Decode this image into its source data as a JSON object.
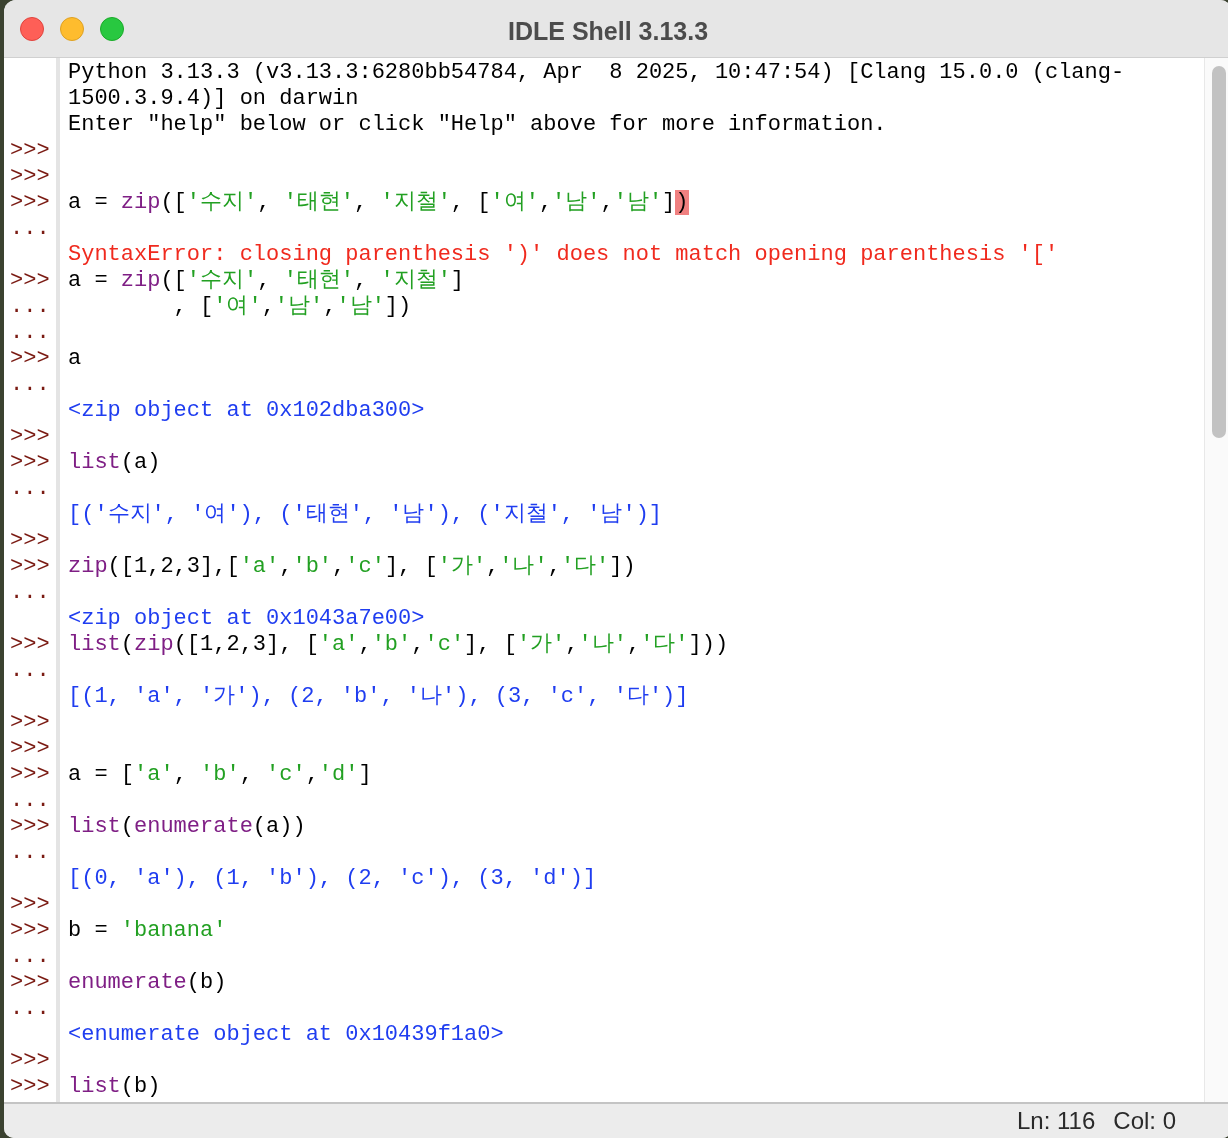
{
  "window": {
    "title": "IDLE Shell 3.13.3"
  },
  "lines": [
    {
      "segments": [
        {
          "text": "Python 3.13.3 (v3.13.3:6280bb54784, Apr  8 2025, 10:47:54) [Clang 15.0.0 (clang-",
          "kind": "plain"
        }
      ]
    },
    {
      "segments": [
        {
          "text": "1500.3.9.4)] on darwin",
          "kind": "plain"
        }
      ]
    },
    {
      "segments": [
        {
          "text": "Enter \"help\" below or click \"Help\" above for more information.",
          "kind": "plain"
        }
      ]
    },
    {
      "prompt": ">>>"
    },
    {
      "prompt": ">>>"
    },
    {
      "prompt": ">>>",
      "segments": [
        {
          "text": "a = ",
          "kind": "plain"
        },
        {
          "text": "zip",
          "kind": "builtin"
        },
        {
          "text": "([",
          "kind": "plain"
        },
        {
          "text": "'수지'",
          "kind": "string"
        },
        {
          "text": ", ",
          "kind": "plain"
        },
        {
          "text": "'태현'",
          "kind": "string"
        },
        {
          "text": ", ",
          "kind": "plain"
        },
        {
          "text": "'지철'",
          "kind": "string"
        },
        {
          "text": ", [",
          "kind": "plain"
        },
        {
          "text": "'여'",
          "kind": "string"
        },
        {
          "text": ",",
          "kind": "plain"
        },
        {
          "text": "'남'",
          "kind": "string"
        },
        {
          "text": ",",
          "kind": "plain"
        },
        {
          "text": "'남'",
          "kind": "string"
        },
        {
          "text": "]",
          "kind": "plain"
        },
        {
          "text": ")",
          "kind": "highlight"
        }
      ]
    },
    {
      "prompt": "..."
    },
    {
      "segments": [
        {
          "text": "SyntaxError: closing parenthesis ')' does not match opening parenthesis '['",
          "kind": "error"
        }
      ]
    },
    {
      "prompt": ">>>",
      "segments": [
        {
          "text": "a = ",
          "kind": "plain"
        },
        {
          "text": "zip",
          "kind": "builtin"
        },
        {
          "text": "([",
          "kind": "plain"
        },
        {
          "text": "'수지'",
          "kind": "string"
        },
        {
          "text": ", ",
          "kind": "plain"
        },
        {
          "text": "'태현'",
          "kind": "string"
        },
        {
          "text": ", ",
          "kind": "plain"
        },
        {
          "text": "'지철'",
          "kind": "string"
        },
        {
          "text": "]",
          "kind": "plain"
        }
      ]
    },
    {
      "prompt": "...",
      "segments": [
        {
          "text": "        , [",
          "kind": "plain"
        },
        {
          "text": "'여'",
          "kind": "string"
        },
        {
          "text": ",",
          "kind": "plain"
        },
        {
          "text": "'남'",
          "kind": "string"
        },
        {
          "text": ",",
          "kind": "plain"
        },
        {
          "text": "'남'",
          "kind": "string"
        },
        {
          "text": "])",
          "kind": "plain"
        }
      ]
    },
    {
      "prompt": "..."
    },
    {
      "prompt": ">>>",
      "segments": [
        {
          "text": "a",
          "kind": "plain"
        }
      ]
    },
    {
      "prompt": "..."
    },
    {
      "segments": [
        {
          "text": "<zip object at 0x102dba300>",
          "kind": "output"
        }
      ]
    },
    {
      "prompt": ">>>"
    },
    {
      "prompt": ">>>",
      "segments": [
        {
          "text": "list",
          "kind": "builtin"
        },
        {
          "text": "(a)",
          "kind": "plain"
        }
      ]
    },
    {
      "prompt": "..."
    },
    {
      "segments": [
        {
          "text": "[('수지', '여'), ('태현', '남'), ('지철', '남')]",
          "kind": "output"
        }
      ]
    },
    {
      "prompt": ">>>"
    },
    {
      "prompt": ">>>",
      "segments": [
        {
          "text": "zip",
          "kind": "builtin"
        },
        {
          "text": "([1,2,3],[",
          "kind": "plain"
        },
        {
          "text": "'a'",
          "kind": "string"
        },
        {
          "text": ",",
          "kind": "plain"
        },
        {
          "text": "'b'",
          "kind": "string"
        },
        {
          "text": ",",
          "kind": "plain"
        },
        {
          "text": "'c'",
          "kind": "string"
        },
        {
          "text": "], [",
          "kind": "plain"
        },
        {
          "text": "'가'",
          "kind": "string"
        },
        {
          "text": ",",
          "kind": "plain"
        },
        {
          "text": "'나'",
          "kind": "string"
        },
        {
          "text": ",",
          "kind": "plain"
        },
        {
          "text": "'다'",
          "kind": "string"
        },
        {
          "text": "])",
          "kind": "plain"
        }
      ]
    },
    {
      "prompt": "..."
    },
    {
      "segments": [
        {
          "text": "<zip object at 0x1043a7e00>",
          "kind": "output"
        }
      ]
    },
    {
      "prompt": ">>>",
      "segments": [
        {
          "text": "list",
          "kind": "builtin"
        },
        {
          "text": "(",
          "kind": "plain"
        },
        {
          "text": "zip",
          "kind": "builtin"
        },
        {
          "text": "([1,2,3], [",
          "kind": "plain"
        },
        {
          "text": "'a'",
          "kind": "string"
        },
        {
          "text": ",",
          "kind": "plain"
        },
        {
          "text": "'b'",
          "kind": "string"
        },
        {
          "text": ",",
          "kind": "plain"
        },
        {
          "text": "'c'",
          "kind": "string"
        },
        {
          "text": "], [",
          "kind": "plain"
        },
        {
          "text": "'가'",
          "kind": "string"
        },
        {
          "text": ",",
          "kind": "plain"
        },
        {
          "text": "'나'",
          "kind": "string"
        },
        {
          "text": ",",
          "kind": "plain"
        },
        {
          "text": "'다'",
          "kind": "string"
        },
        {
          "text": "]))",
          "kind": "plain"
        }
      ]
    },
    {
      "prompt": "..."
    },
    {
      "segments": [
        {
          "text": "[(1, 'a', '가'), (2, 'b', '나'), (3, 'c', '다')]",
          "kind": "output"
        }
      ]
    },
    {
      "prompt": ">>>"
    },
    {
      "prompt": ">>>"
    },
    {
      "prompt": ">>>",
      "segments": [
        {
          "text": "a = [",
          "kind": "plain"
        },
        {
          "text": "'a'",
          "kind": "string"
        },
        {
          "text": ", ",
          "kind": "plain"
        },
        {
          "text": "'b'",
          "kind": "string"
        },
        {
          "text": ", ",
          "kind": "plain"
        },
        {
          "text": "'c'",
          "kind": "string"
        },
        {
          "text": ",",
          "kind": "plain"
        },
        {
          "text": "'d'",
          "kind": "string"
        },
        {
          "text": "]",
          "kind": "plain"
        }
      ]
    },
    {
      "prompt": "..."
    },
    {
      "prompt": ">>>",
      "segments": [
        {
          "text": "list",
          "kind": "builtin"
        },
        {
          "text": "(",
          "kind": "plain"
        },
        {
          "text": "enumerate",
          "kind": "builtin"
        },
        {
          "text": "(a))",
          "kind": "plain"
        }
      ]
    },
    {
      "prompt": "..."
    },
    {
      "segments": [
        {
          "text": "[(0, 'a'), (1, 'b'), (2, 'c'), (3, 'd')]",
          "kind": "output"
        }
      ]
    },
    {
      "prompt": ">>>"
    },
    {
      "prompt": ">>>",
      "segments": [
        {
          "text": "b = ",
          "kind": "plain"
        },
        {
          "text": "'banana'",
          "kind": "string"
        }
      ]
    },
    {
      "prompt": "..."
    },
    {
      "prompt": ">>>",
      "segments": [
        {
          "text": "enumerate",
          "kind": "builtin"
        },
        {
          "text": "(b)",
          "kind": "plain"
        }
      ]
    },
    {
      "prompt": "..."
    },
    {
      "segments": [
        {
          "text": "<enumerate object at 0x10439f1a0>",
          "kind": "output"
        }
      ]
    },
    {
      "prompt": ">>>"
    },
    {
      "prompt": ">>>",
      "segments": [
        {
          "text": "list",
          "kind": "builtin"
        },
        {
          "text": "(b)",
          "kind": "plain"
        }
      ]
    }
  ],
  "status_bar": {
    "line": "Ln: 116",
    "column": "Col: 0"
  }
}
